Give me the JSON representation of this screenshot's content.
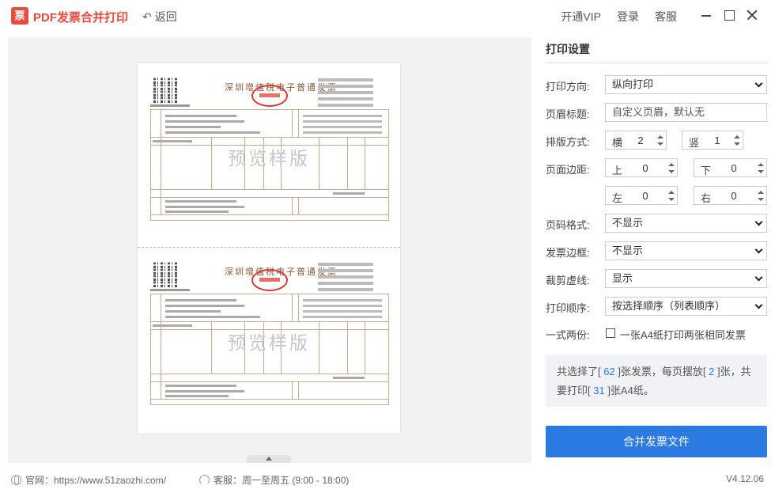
{
  "app": {
    "logo_char": "票",
    "title": "PDF发票合并打印",
    "back_label": "返回",
    "top_links": {
      "vip": "开通VIP",
      "login": "登录",
      "service": "客服"
    }
  },
  "preview": {
    "invoice_title": "深圳增值税电子普通发票",
    "watermark": "预览样版"
  },
  "settings": {
    "title": "打印设置",
    "orientation": {
      "label": "打印方向:",
      "value": "纵向打印"
    },
    "header_title": {
      "label": "页眉标题:",
      "placeholder": "自定义页眉，默认无"
    },
    "layout": {
      "label": "排版方式:",
      "horizontal_label": "横",
      "horizontal_value": "2",
      "vertical_label": "竖",
      "vertical_value": "1"
    },
    "margins": {
      "label": "页面边距:",
      "top_label": "上",
      "top_value": "0",
      "bottom_label": "下",
      "bottom_value": "0",
      "left_label": "左",
      "left_value": "0",
      "right_label": "右",
      "right_value": "0"
    },
    "page_number": {
      "label": "页码格式:",
      "value": "不显示"
    },
    "invoice_border": {
      "label": "发票边框:",
      "value": "不显示"
    },
    "cut_line": {
      "label": "裁剪虚线:",
      "value": "显示"
    },
    "print_order": {
      "label": "打印顺序:",
      "value": "按选择顺序（列表顺序）"
    },
    "duplicate": {
      "label": "一式两份:",
      "checkbox_label": "一张A4纸打印两张相同发票",
      "checked": false
    },
    "summary": {
      "part1": "共选择了[ ",
      "selected": "62",
      "part2": " ]张发票，每页摆放[ ",
      "per_page": "2",
      "part3": " ]张，共要打印[ ",
      "pages": "31",
      "part4": " ]张A4纸。"
    },
    "merge_button": "合并发票文件"
  },
  "footer": {
    "website_label": "官网：https://www.51zaozhi.com/",
    "service_label": "客服：周一至周五 (9:00 - 18:00)",
    "version": "V4.12.06"
  },
  "colors": {
    "accent": "#2a7ae2",
    "brand": "#e94b3c"
  }
}
